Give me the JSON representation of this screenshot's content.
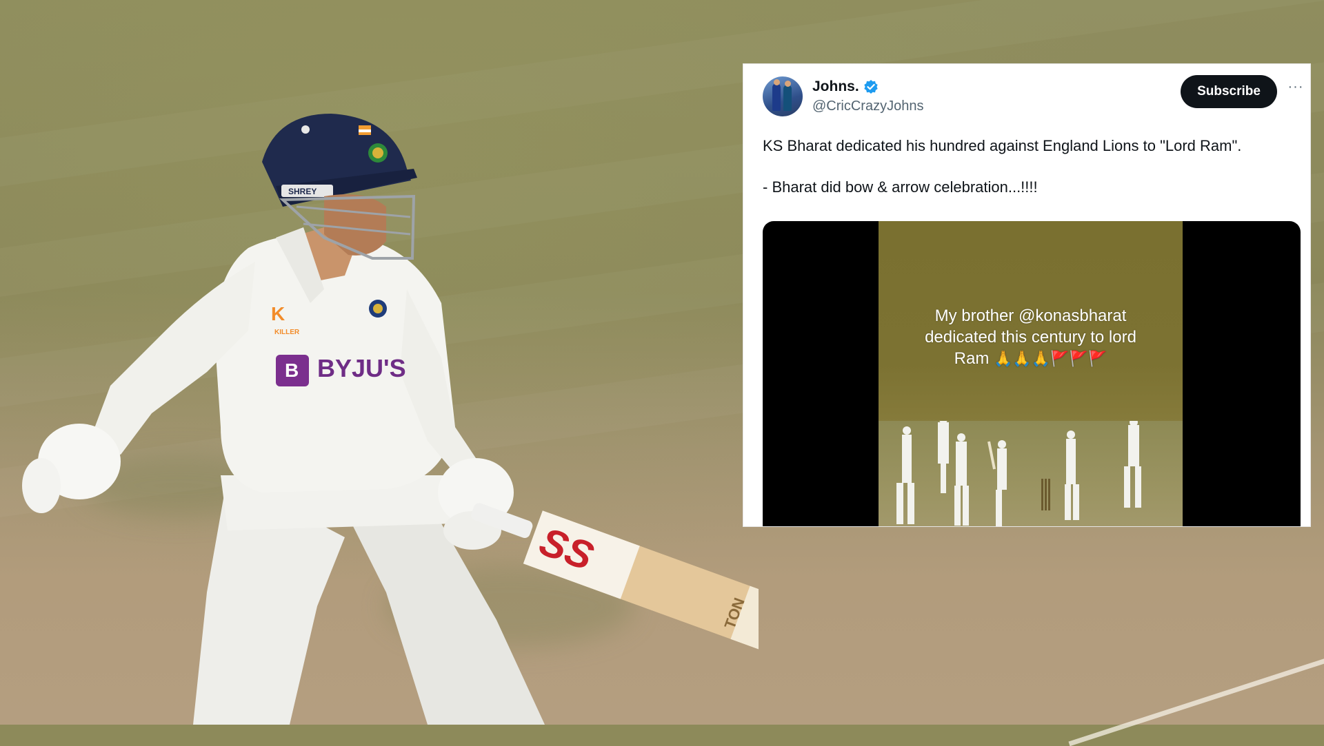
{
  "tweet": {
    "display_name": "Johns.",
    "handle": "@CricCrazyJohns",
    "subscribe_label": "Subscribe",
    "more_label": "···",
    "text": "KS Bharat dedicated his hundred against England Lions to \"Lord Ram\".\n\n- Bharat did bow & arrow celebration...!!!!",
    "media_overlay": {
      "line1": "My brother @konasbharat",
      "line2": "dedicated this century to lord",
      "line3_word": "Ram",
      "line3_emoji": "🙏🙏🙏🚩🚩🚩"
    }
  },
  "photo": {
    "helmet_label": "SHREY",
    "shirt_logo": "KILLER",
    "sponsor": "BYJU'S",
    "bat_brand": "SS",
    "bat_text": "TON"
  }
}
